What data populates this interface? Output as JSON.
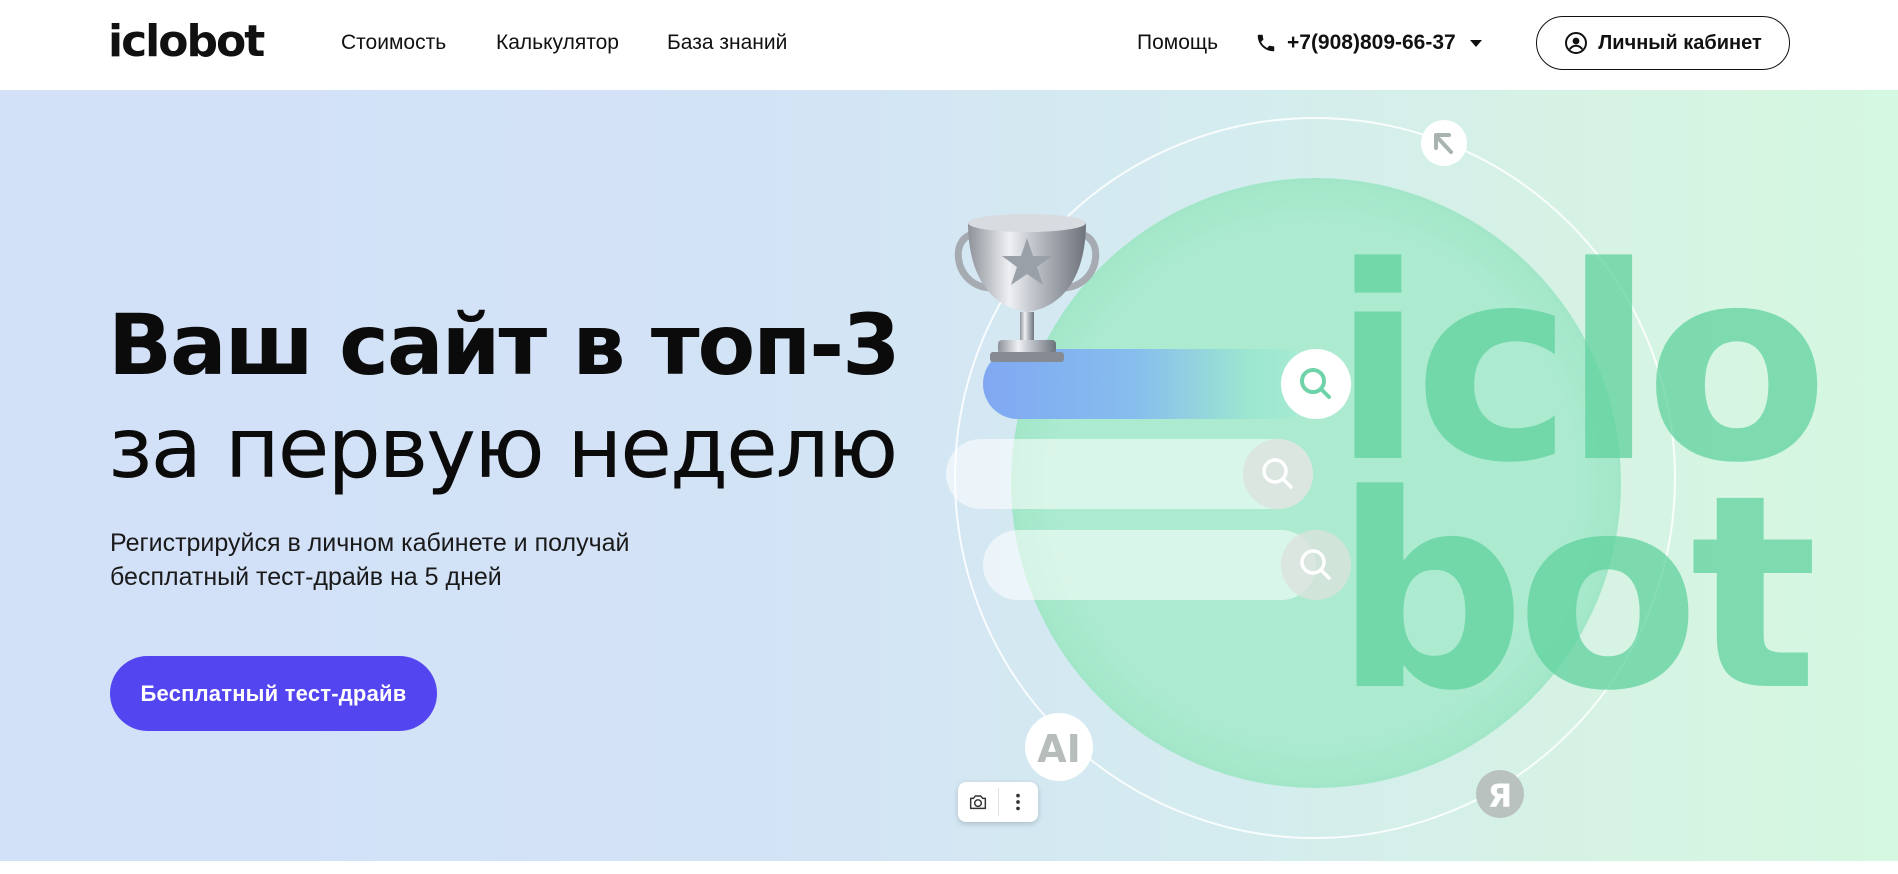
{
  "header": {
    "logo": "iclobot",
    "nav": [
      {
        "label": "Стоимость"
      },
      {
        "label": "Калькулятор"
      },
      {
        "label": "База знаний"
      }
    ],
    "help": "Помощь",
    "phone": "+7(908)809-66-37",
    "cabinet_label": "Личный кабинет"
  },
  "hero": {
    "title_bold": "Ваш сайт в топ-3",
    "title_light": "за первую неделю",
    "subtitle_line1": "Регистрируйся в личном кабинете и получай",
    "subtitle_line2": "бесплатный тест-драйв на 5 дней",
    "cta_label": "Бесплатный тест-драйв"
  },
  "illustration": {
    "watermark_line1": "iclo",
    "watermark_line2": "bot",
    "badge_ai": "AI",
    "badge_yandex": "Я",
    "icons": [
      "trophy-icon",
      "search-icon",
      "arrow-up-left-icon",
      "camera-icon",
      "more-vertical-icon"
    ]
  },
  "colors": {
    "accent": "#5345f0",
    "green_circle": "#a9ecd0",
    "green_letters": "#6fd9aa",
    "search_bar_gradient_start": "#80a8f2",
    "search_bar_gradient_end": "#9de6d0"
  }
}
